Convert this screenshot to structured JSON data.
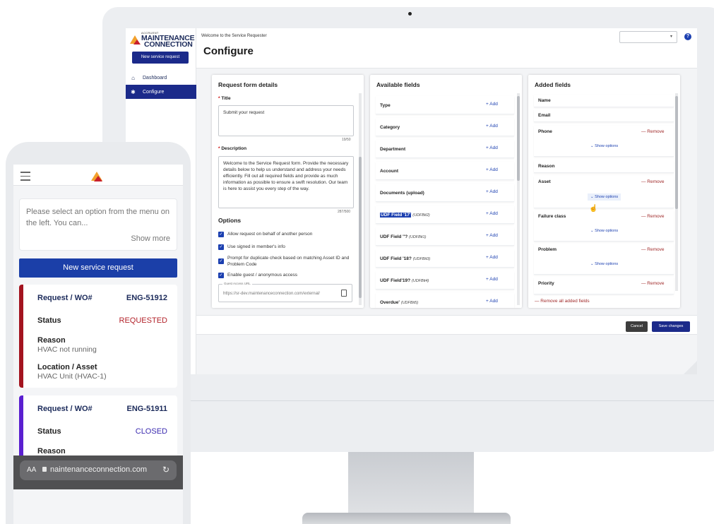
{
  "desktop": {
    "brand": {
      "tiny": "ACCRUENT",
      "line1": "MAINTENANCE",
      "line2": "CONNECTION"
    },
    "new_request_button": "New service request",
    "nav": [
      {
        "label": "Dashboard",
        "icon": "home-icon"
      },
      {
        "label": "Configure",
        "icon": "gear-icon",
        "active": true
      }
    ],
    "welcome": "Welcome to the Service Requester",
    "page_title": "Configure",
    "dropdown_value": "",
    "help_glyph": "?",
    "request_form": {
      "title": "Request form details",
      "title_label": "Title",
      "title_value": "Submit your request",
      "title_count": "19/50",
      "description_label": "Description",
      "description_value": "Welcome to the Service Request form. Provide the necessary details below to help us understand and address your needs efficiently. Fill out all required fields and provide as much information as possible to ensure a swift resolution. Our team is here to assist you every step of the way.",
      "description_count": "287/500",
      "options_title": "Options",
      "options": [
        "Allow request on behalf of another person",
        "Use signed in member's info",
        "Prompt for duplicate check based on matching Asset ID and Problem Code",
        "Enable guest / anonymous access"
      ],
      "guest_url_label": "Guest Access URL",
      "guest_url_value": "https://sr-dev.maintenanceconnection.com/external/"
    },
    "available_fields": {
      "title": "Available fields",
      "add_label": "+ Add",
      "fields": [
        {
          "name": "Type",
          "code": ""
        },
        {
          "name": "Category",
          "code": ""
        },
        {
          "name": "Department",
          "code": ""
        },
        {
          "name": "Account",
          "code": ""
        },
        {
          "name": "Documents (upload)",
          "code": ""
        },
        {
          "name": "UDF Field '17'",
          "code": "(UDFBit2)"
        },
        {
          "name": "UDF Field ''?",
          "code": "(UDFBit1)"
        },
        {
          "name": "UDF Field '18?",
          "code": "(UDFBit3)"
        },
        {
          "name": "UDF Field'19?",
          "code": "(UDFBit4)"
        },
        {
          "name": "Overdue'",
          "code": "(UDFBit5)"
        }
      ]
    },
    "added_fields": {
      "title": "Added fields",
      "remove_label": "— Remove",
      "show_options_label": "Show options",
      "remove_all_label": "— Remove all added fields",
      "fields": [
        {
          "name": "Name"
        },
        {
          "name": "Email"
        },
        {
          "name": "Phone"
        },
        {
          "name": "Reason"
        },
        {
          "name": "Asset"
        },
        {
          "name": "Failure class"
        },
        {
          "name": "Problem"
        },
        {
          "name": "Priority"
        }
      ]
    },
    "cancel_button": "Cancel",
    "save_button": "Save changes"
  },
  "phone": {
    "info_text": "Please select an option from the menu on the left. You can...",
    "show_more": "Show more",
    "new_request_button": "New service request",
    "cards": [
      {
        "accent": "#a3141f",
        "request_label": "Request / WO#",
        "request_value": "ENG-51912",
        "status_label": "Status",
        "status_value": "REQUESTED",
        "status_color": "#b3232b",
        "reason_label": "Reason",
        "reason_value": "HVAC not running",
        "location_label": "Location / Asset",
        "location_value": "HVAC Unit (HVAC-1)"
      },
      {
        "accent": "#5a1fd0",
        "request_label": "Request / WO#",
        "request_value": "ENG-51911",
        "status_label": "Status",
        "status_value": "CLOSED",
        "status_color": "#3b2bb0",
        "reason_label": "Reason"
      }
    ],
    "url_bar": {
      "aa": "AA",
      "url": "naintenanceconnection.com"
    }
  },
  "colors": {
    "brand_navy": "#1b2a8a",
    "accent_blue": "#1b3fb0",
    "remove_red": "#a02a2a"
  }
}
